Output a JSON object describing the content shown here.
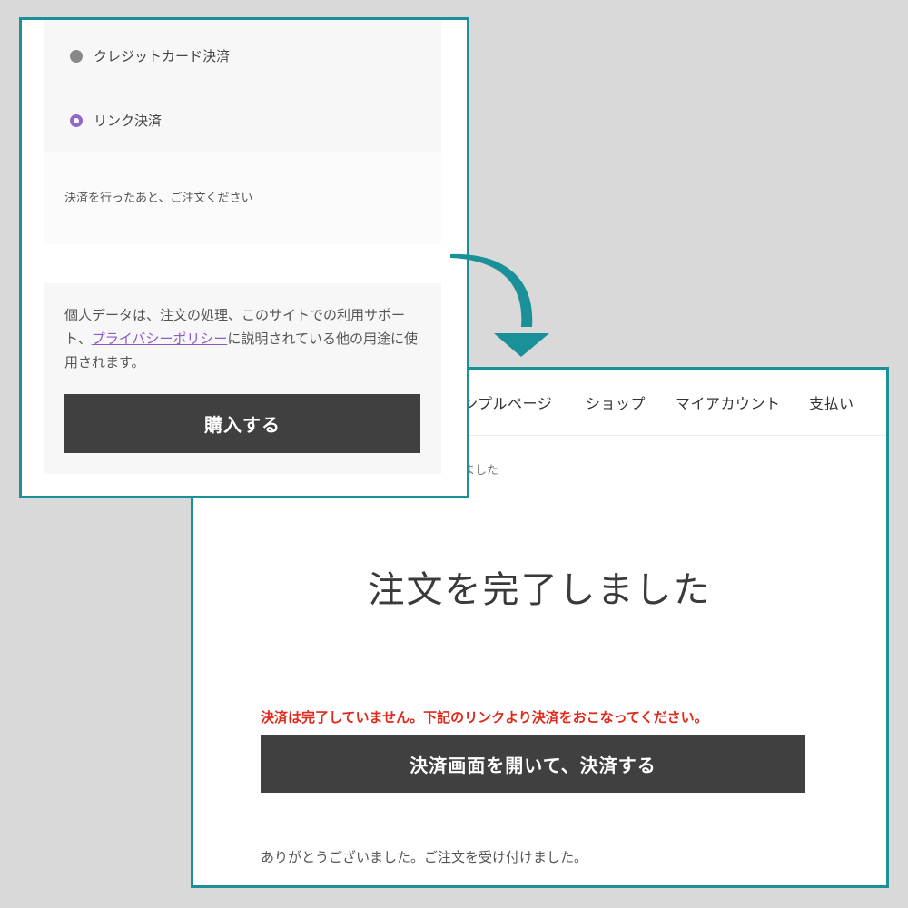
{
  "front_panel": {
    "payment_methods": [
      {
        "label": "クレジットカード決済",
        "selected": false
      },
      {
        "label": "リンク決済",
        "selected": true
      }
    ],
    "method_note": "決済を行ったあと、ご注文ください",
    "privacy": {
      "text_before": "個人データは、注文の処理、このサイトでの利用サポート、",
      "link_label": "プライバシーポリシー",
      "text_after": "に説明されている他の用途に使用されます。"
    },
    "buy_button_label": "購入する"
  },
  "back_panel": {
    "nav": [
      "ンプルページ",
      "ショップ",
      "マイアカウント",
      "支払い"
    ],
    "breadcrumb_fragment": "ました",
    "title": "注文を完了しました",
    "warning": "決済は完了していません。下記のリンクより決済をおこなってください。",
    "pay_button_label": "決済画面を開いて、決済する",
    "thanks_message": "ありがとうございました。ご注文を受け付けました。"
  },
  "colors": {
    "frame_border": "#1a9098",
    "arrow": "#1a9098",
    "button_bg": "#404040",
    "warning_text": "#e0291b",
    "radio_selected": "#9467c6",
    "link": "#8a5cc4",
    "background": "#d9d9d9"
  },
  "icons": [
    "radio-unselected-icon",
    "radio-selected-icon",
    "curved-arrow-icon"
  ]
}
